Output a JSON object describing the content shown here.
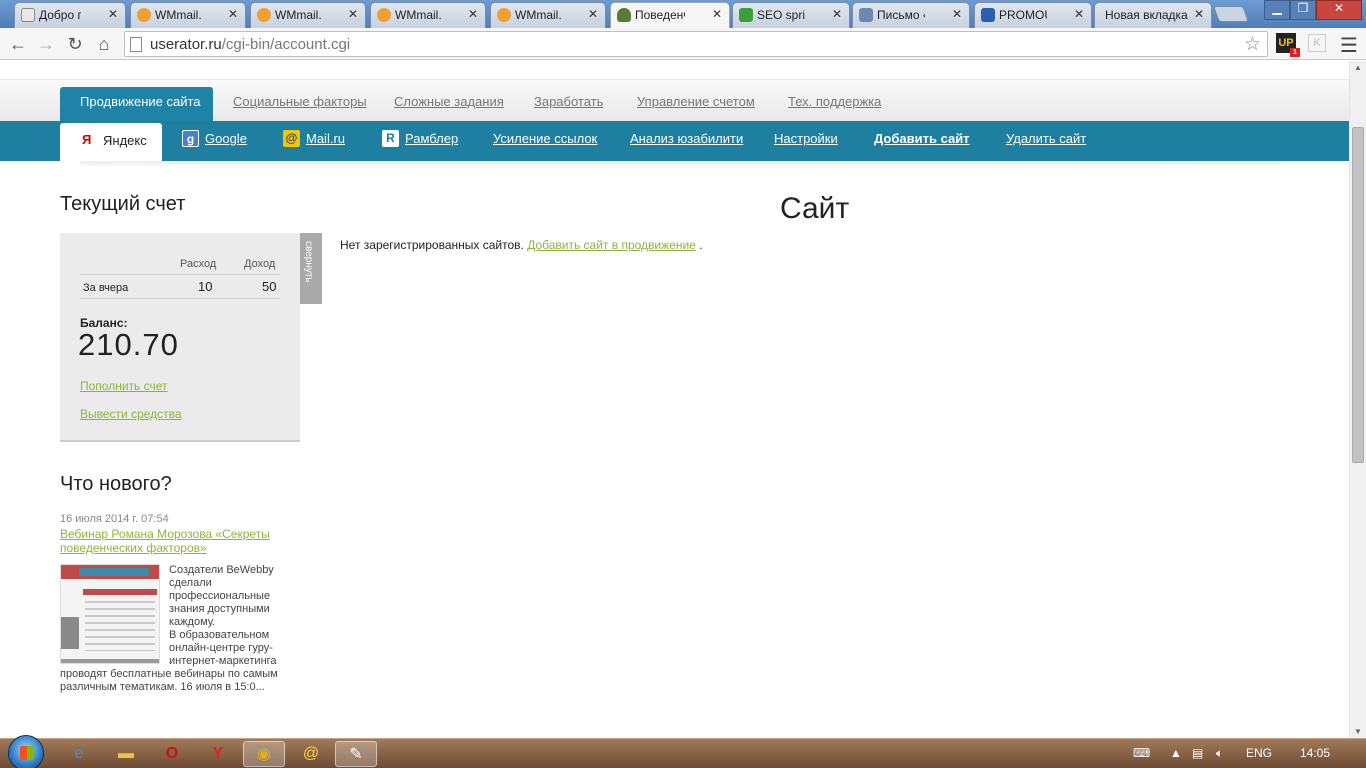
{
  "browser": {
    "tabs": [
      {
        "title": "Добро пож",
        "favicon": "doc-icon",
        "color": "#e8e8e8"
      },
      {
        "title": "WMmail.ru",
        "favicon": "wmmail-icon",
        "color": "#f0a030"
      },
      {
        "title": "WMmail.ru",
        "favicon": "wmmail-icon",
        "color": "#f0a030"
      },
      {
        "title": "WMmail.ru",
        "favicon": "wmmail-icon",
        "color": "#f0a030"
      },
      {
        "title": "WMmail.ru",
        "favicon": "wmmail-icon",
        "color": "#f0a030"
      },
      {
        "title": "Поведенчес",
        "favicon": "userator-icon",
        "color": "#5a7a3a",
        "active": true
      },
      {
        "title": "SEO sprint",
        "favicon": "seosprint-icon",
        "color": "#3aa03a"
      },
      {
        "title": "Письмо «Кс",
        "favicon": "mail-icon",
        "color": "#6a8ab0"
      },
      {
        "title": "PROMOUTER",
        "favicon": "promouter-icon",
        "color": "#2a5fb0"
      },
      {
        "title": "Новая вкладка",
        "favicon": "",
        "color": ""
      }
    ],
    "url_host": "userator.ru",
    "url_path": "/cgi-bin/account.cgi",
    "ext_up_label": "UP",
    "ext_up_badge": "1",
    "ext_k_label": "K"
  },
  "page": {
    "top_tabs": {
      "active": "Продвижение сайта",
      "items": [
        "Социальные факторы",
        "Сложные задания",
        "Заработать",
        "Управление счетом",
        "Тех. поддержка"
      ]
    },
    "sub_tabs": {
      "active": "Яндекс",
      "items": [
        "Google",
        "Mail.ru",
        "Рамблер",
        "Усиление ссылок",
        "Анализ юзабилити",
        "Настройки",
        "Добавить сайт",
        "Удалить сайт"
      ]
    },
    "account": {
      "heading": "Текущий счет",
      "col_expense": "Расход",
      "col_income": "Доход",
      "row_label": "За вчера",
      "row_expense": "10",
      "row_income": "50",
      "balance_label": "Баланс:",
      "balance_value": "210.70",
      "topup_link": "Пополнить счет",
      "withdraw_link": "Вывести средства",
      "collapse_label": "свернуть"
    },
    "site": {
      "heading": "Сайт",
      "no_sites_text": "Нет зарегистрированных сайтов.",
      "add_link": "Добавить сайт в продвижение",
      "trailing": "."
    },
    "news": {
      "heading": "Что нового?",
      "date": "16 июля 2014 г. 07:54",
      "title": "Вебинар Романа Морозова «Секреты поведенческих факторов»",
      "text_lines": [
        "Создатели BeWebby",
        "сделали",
        "профессиональные",
        "знания доступными",
        "каждому.",
        "В образовательном",
        "онлайн-центре гуру-",
        "интернет-маркетинга"
      ],
      "text_tail": [
        "проводят бесплатные вебинары по самым",
        "различным тематикам. 16 июля в 15:0..."
      ]
    }
  },
  "taskbar": {
    "language": "ENG",
    "clock": "14:05"
  }
}
